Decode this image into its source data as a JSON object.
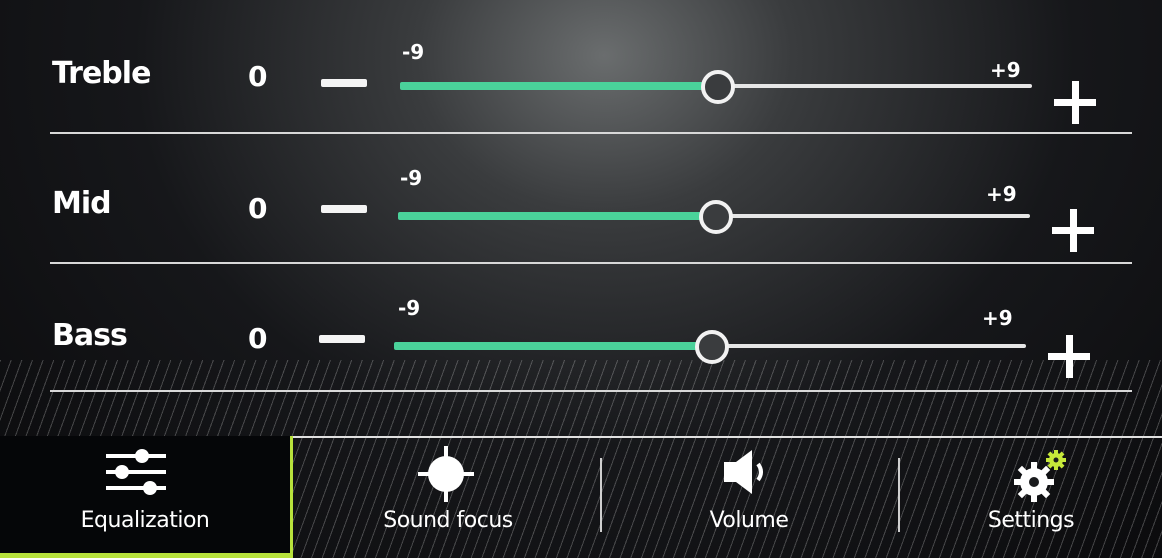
{
  "equalizer": {
    "rows": [
      {
        "label": "Treble",
        "value": "0",
        "min_label": "-9",
        "max_label": "+9",
        "level": 0
      },
      {
        "label": "Mid",
        "value": "0",
        "min_label": "-9",
        "max_label": "+9",
        "level": 0
      },
      {
        "label": "Bass",
        "value": "0",
        "min_label": "-9",
        "max_label": "+9",
        "level": 0
      }
    ],
    "range": [
      -9,
      9
    ]
  },
  "tabs": [
    {
      "label": "Equalization",
      "icon": "sliders-icon",
      "active": true
    },
    {
      "label": "Sound focus",
      "icon": "crosshair-icon",
      "active": false
    },
    {
      "label": "Volume",
      "icon": "speaker-icon",
      "active": false
    },
    {
      "label": "Settings",
      "icon": "gears-icon",
      "active": false
    }
  ],
  "colors": {
    "slider_fill": "#4ad29a",
    "active_tab_accent": "#b8e23c",
    "settings_gear_accent": "#c6e83a"
  }
}
